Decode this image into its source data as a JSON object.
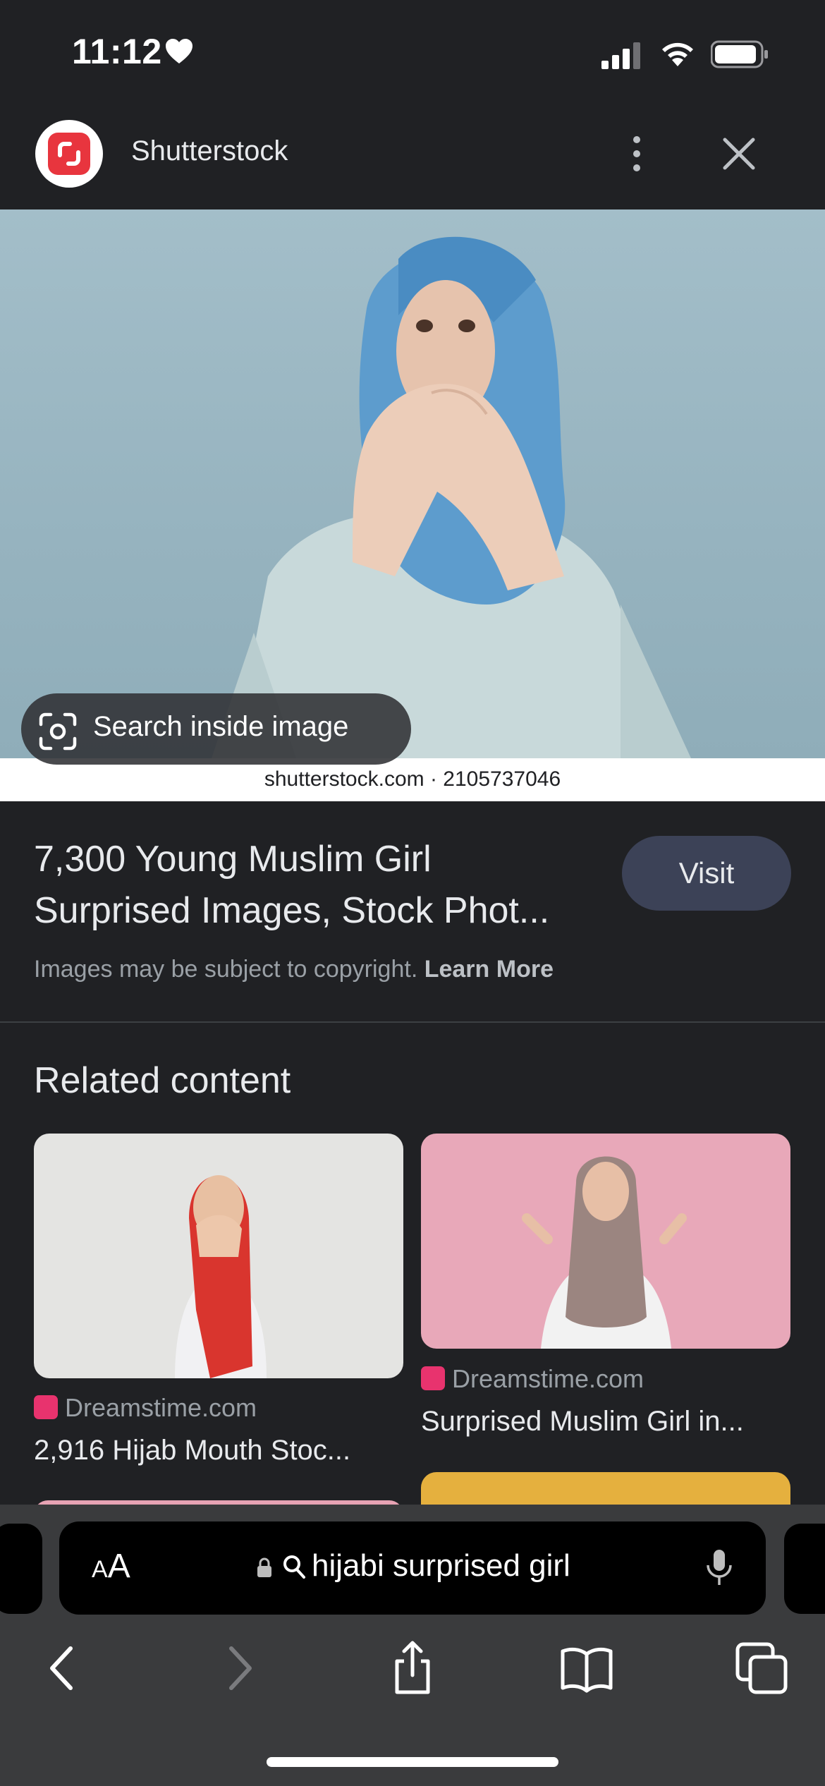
{
  "status_bar": {
    "time": "11:12"
  },
  "header": {
    "site_name": "Shutterstock"
  },
  "hero": {
    "search_inside_label": "Search inside image",
    "credit": "shutterstock.com · 2105737046"
  },
  "result": {
    "title_line1": "7,300 Young Muslim Girl",
    "title_line2": "Surprised Images, Stock Phot...",
    "visit_label": "Visit",
    "copyright_text": "Images may be subject to copyright.",
    "learn_more": "Learn More"
  },
  "related": {
    "heading": "Related content",
    "items": [
      {
        "source": "Dreamstime.com",
        "caption": "2,916 Hijab Mouth Stoc..."
      },
      {
        "source": "Dreamstime.com",
        "caption": "Surprised Muslim Girl in..."
      }
    ]
  },
  "address_bar": {
    "text_size_label_small": "A",
    "text_size_label_large": "A",
    "query": "hijabi surprised girl"
  },
  "colors": {
    "background": "#202124",
    "visit_button": "#3c4257",
    "brand_red": "#e8353e",
    "toolbar": "#3a3b3d"
  }
}
